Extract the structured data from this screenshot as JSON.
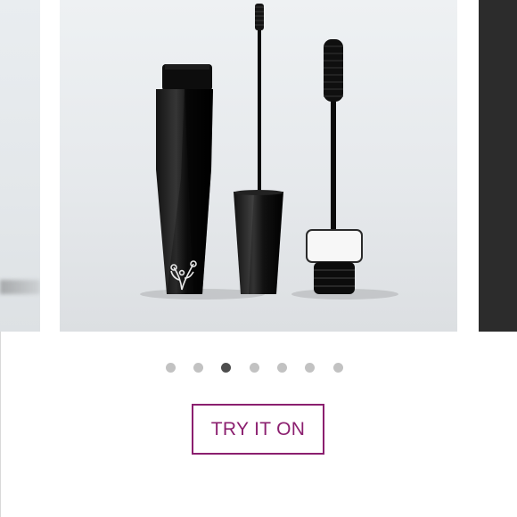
{
  "carousel": {
    "slide_count": 7,
    "active_index": 2,
    "image_description": "mascara"
  },
  "cta": {
    "label": "TRY IT ON"
  },
  "colors": {
    "accent": "#8b1f6f",
    "dot_inactive": "#c2c2c2",
    "dot_active": "#4d4d4d",
    "next_slide_bg": "#2c2c2c"
  }
}
